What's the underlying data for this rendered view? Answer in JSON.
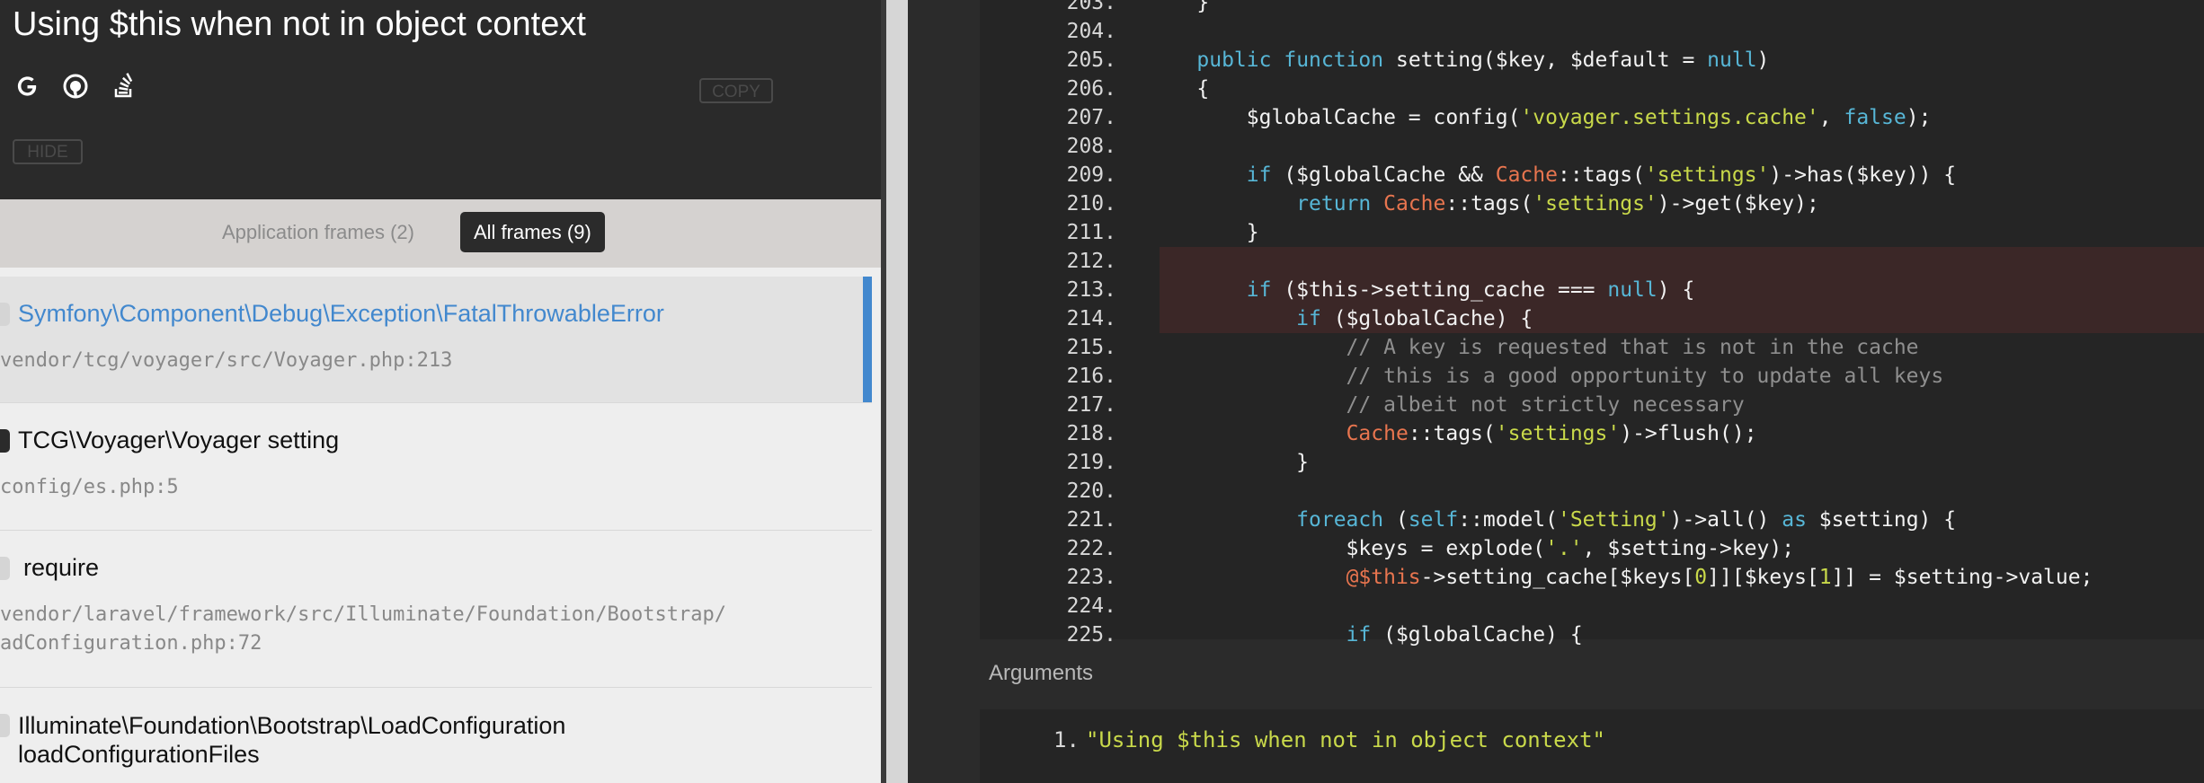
{
  "exception": {
    "message": "Using $this when not in object context",
    "copy_label": "COPY",
    "hide_label": "HIDE",
    "search_icons": [
      "google-icon",
      "duckduckgo-icon",
      "stackoverflow-icon"
    ]
  },
  "filters": {
    "application_frames": "Application frames (2)",
    "all_frames": "All frames (9)"
  },
  "frames": [
    {
      "class": "Symfony\\Component\\Debug\\Exception\\FatalThrowableError",
      "file": "vendor/tcg/voyager/src/Voyager.php:213",
      "active": true
    },
    {
      "class": "TCG\\Voyager\\Voyager setting",
      "file": "config/es.php:5",
      "active": false
    },
    {
      "class": "require",
      "file": "vendor/laravel/framework/src/Illuminate/Foundation/Bootstrap/\nadConfiguration.php:72",
      "active": false
    },
    {
      "class": "Illuminate\\Foundation\\Bootstrap\\LoadConfiguration\nloadConfigurationFiles",
      "file": "",
      "active": false
    }
  ],
  "code": {
    "highlighted_lines": [
      "212.",
      "213.",
      "214."
    ],
    "lines": [
      {
        "n": "203.",
        "text": "    }"
      },
      {
        "n": "204.",
        "text": ""
      },
      {
        "n": "205.",
        "text": "    public function setting($key, $default = null)"
      },
      {
        "n": "206.",
        "text": "    {"
      },
      {
        "n": "207.",
        "text": "        $globalCache = config('voyager.settings.cache', false);"
      },
      {
        "n": "208.",
        "text": ""
      },
      {
        "n": "209.",
        "text": "        if ($globalCache && Cache::tags('settings')->has($key)) {"
      },
      {
        "n": "210.",
        "text": "            return Cache::tags('settings')->get($key);"
      },
      {
        "n": "211.",
        "text": "        }"
      },
      {
        "n": "212.",
        "text": ""
      },
      {
        "n": "213.",
        "text": "        if ($this->setting_cache === null) {"
      },
      {
        "n": "214.",
        "text": "            if ($globalCache) {"
      },
      {
        "n": "215.",
        "text": "                // A key is requested that is not in the cache"
      },
      {
        "n": "216.",
        "text": "                // this is a good opportunity to update all keys"
      },
      {
        "n": "217.",
        "text": "                // albeit not strictly necessary"
      },
      {
        "n": "218.",
        "text": "                Cache::tags('settings')->flush();"
      },
      {
        "n": "219.",
        "text": "            }"
      },
      {
        "n": "220.",
        "text": ""
      },
      {
        "n": "221.",
        "text": "            foreach (self::model('Setting')->all() as $setting) {"
      },
      {
        "n": "222.",
        "text": "                $keys = explode('.', $setting->key);"
      },
      {
        "n": "223.",
        "text": "                @$this->setting_cache[$keys[0]][$keys[1]] = $setting->value;"
      },
      {
        "n": "224.",
        "text": ""
      },
      {
        "n": "225.",
        "text": "                if ($globalCache) {"
      }
    ]
  },
  "arguments": {
    "header": "Arguments",
    "items": [
      {
        "n": "1.",
        "value": "\"Using $this when not in object context\""
      }
    ]
  },
  "colors": {
    "accent": "#4288ce",
    "keyword": "#57b6d6",
    "class": "#e8754f",
    "string": "#c9d94a",
    "comment": "#8f8f8f",
    "highlight": "#3b2727"
  }
}
